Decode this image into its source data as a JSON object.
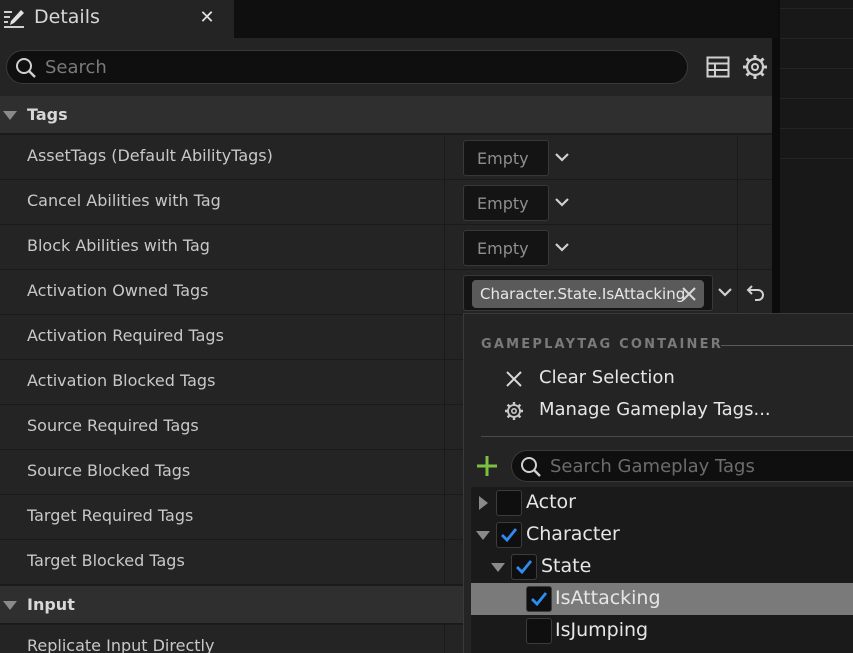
{
  "tab": {
    "title": "Details",
    "close_symbol": "✕"
  },
  "search": {
    "placeholder": "Search"
  },
  "sections": {
    "tags_label": "Tags",
    "input_label": "Input"
  },
  "rows": [
    {
      "name": "AssetTags (Default AbilityTags)",
      "value": "Empty"
    },
    {
      "name": "Cancel Abilities with Tag",
      "value": "Empty"
    },
    {
      "name": "Block Abilities with Tag",
      "value": "Empty"
    },
    {
      "name": "Activation Owned Tags",
      "tag": "Character.State.IsAttacking"
    },
    {
      "name": "Activation Required Tags"
    },
    {
      "name": "Activation Blocked Tags"
    },
    {
      "name": "Source Required Tags"
    },
    {
      "name": "Source Blocked Tags"
    },
    {
      "name": "Target Required Tags"
    },
    {
      "name": "Target Blocked Tags"
    }
  ],
  "input_rows": [
    {
      "name": "Replicate Input Directly"
    }
  ],
  "dropdown": {
    "heading": "GAMEPLAYTAG CONTAINER",
    "clear_label": "Clear Selection",
    "manage_label": "Manage Gameplay Tags...",
    "tag_search_placeholder": "Search Gameplay Tags",
    "tree": [
      {
        "label": "Actor",
        "checked": false,
        "expanded": false
      },
      {
        "label": "Character",
        "checked": true,
        "expanded": true
      },
      {
        "label": "State",
        "checked": true,
        "expanded": true
      },
      {
        "label": "IsAttacking",
        "checked": true,
        "selected": true
      },
      {
        "label": "IsJumping",
        "checked": false
      }
    ]
  },
  "colors": {
    "checkmark": "#2f8cf4",
    "plus": "#7bc043",
    "selected_row": "#7a7a7a"
  }
}
